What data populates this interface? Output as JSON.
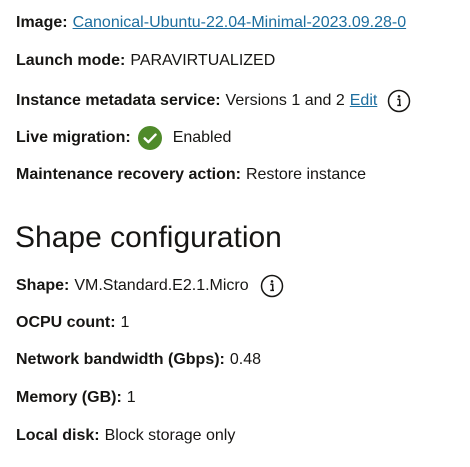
{
  "instance": {
    "image_label": "Image:",
    "image_value": "Canonical-Ubuntu-22.04-Minimal-2023.09.28-0",
    "launch_mode_label": "Launch mode:",
    "launch_mode_value": "PARAVIRTUALIZED",
    "metadata_label": "Instance metadata service:",
    "metadata_value": "Versions 1 and 2",
    "metadata_edit": "Edit",
    "live_migration_label": "Live migration:",
    "live_migration_value": "Enabled",
    "maintenance_label": "Maintenance recovery action:",
    "maintenance_value": "Restore instance"
  },
  "shape_config": {
    "title": "Shape configuration",
    "shape_label": "Shape:",
    "shape_value": "VM.Standard.E2.1.Micro",
    "ocpu_label": "OCPU count:",
    "ocpu_value": "1",
    "bandwidth_label": "Network bandwidth (Gbps):",
    "bandwidth_value": "0.48",
    "memory_label": "Memory (GB):",
    "memory_value": "1",
    "disk_label": "Local disk:",
    "disk_value": "Block storage only"
  },
  "icons": {
    "info": "info-icon",
    "check": "check-circle-icon"
  },
  "colors": {
    "link": "#1d6e9f",
    "success": "#4f8a2a",
    "text": "#161513"
  }
}
